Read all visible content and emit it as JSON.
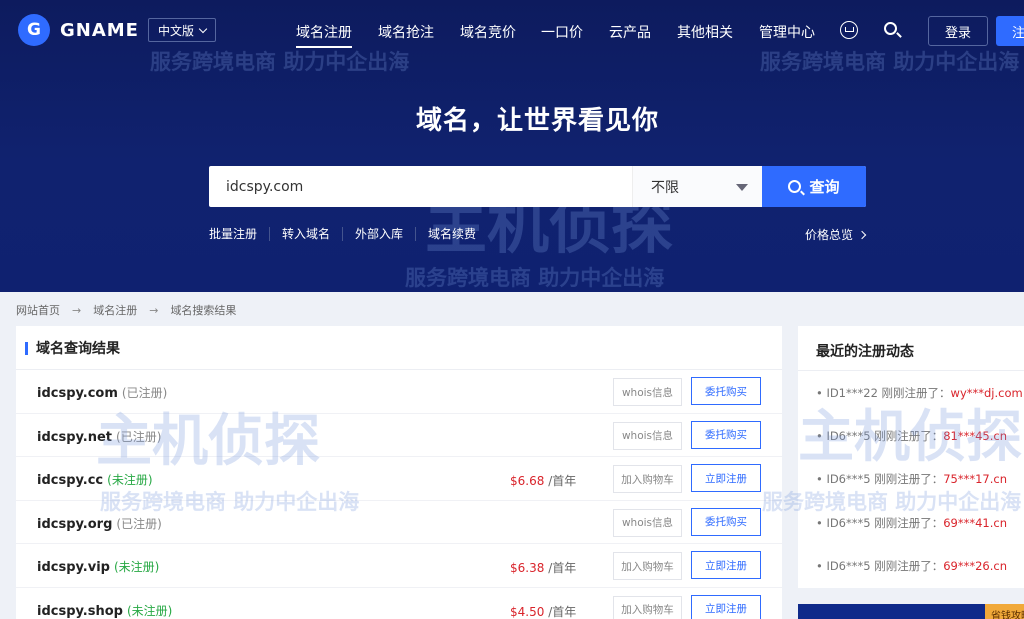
{
  "nav": {
    "logo_text": "GNAME",
    "logo_letter": "G",
    "lang": "中文版",
    "items": [
      "域名注册",
      "域名抢注",
      "域名竞价",
      "一口价",
      "云产品",
      "其他相关",
      "管理中心"
    ],
    "login": "登录",
    "register": "注册"
  },
  "watermark": {
    "brand": "主机侦探",
    "slogan": "服务跨境电商 助力中企出海"
  },
  "hero": {
    "slogan": "域名，让世界看见你"
  },
  "search": {
    "value": "idcspy.com",
    "filter": "不限",
    "button": "查询"
  },
  "quick_links": [
    "批量注册",
    "转入域名",
    "外部入库",
    "域名续费"
  ],
  "price_overview": "价格总览",
  "breadcrumb": [
    "网站首页",
    "域名注册",
    "域名搜索结果"
  ],
  "results": {
    "title": "域名查询结果",
    "rows": [
      {
        "domain": "idcspy.com",
        "status": "(已注册)",
        "price": "",
        "unit": "",
        "btn_a": "whois信息",
        "btn_b": "委托购买"
      },
      {
        "domain": "idcspy.net",
        "status": "(已注册)",
        "price": "",
        "unit": "",
        "btn_a": "whois信息",
        "btn_b": "委托购买"
      },
      {
        "domain": "idcspy.cc",
        "status": "(未注册)",
        "price": "$6.68",
        "unit": "/首年",
        "btn_a": "加入购物车",
        "btn_b": "立即注册"
      },
      {
        "domain": "idcspy.org",
        "status": "(已注册)",
        "price": "",
        "unit": "",
        "btn_a": "whois信息",
        "btn_b": "委托购买"
      },
      {
        "domain": "idcspy.vip",
        "status": "(未注册)",
        "price": "$6.38",
        "unit": "/首年",
        "btn_a": "加入购物车",
        "btn_b": "立即注册"
      },
      {
        "domain": "idcspy.shop",
        "status": "(未注册)",
        "price": "$4.50",
        "unit": "/首年",
        "btn_a": "加入购物车",
        "btn_b": "立即注册"
      }
    ]
  },
  "activity": {
    "title": "最近的注册动态",
    "items": [
      {
        "text": "• ID1***22 刚刚注册了：",
        "domain": "wy***dj.com"
      },
      {
        "text": "• ID6***5 刚刚注册了：",
        "domain": "81***45.cn"
      },
      {
        "text": "• ID6***5 刚刚注册了：",
        "domain": "75***17.cn"
      },
      {
        "text": "• ID6***5 刚刚注册了：",
        "domain": "69***41.cn"
      },
      {
        "text": "• ID6***5 刚刚注册了：",
        "domain": "69***26.cn"
      }
    ]
  },
  "banner_tag": "省钱攻略",
  "colors": {
    "accent": "#2f6bff",
    "hero_bg": "#10226f",
    "price": "#d9242b",
    "available": "#27a844"
  }
}
